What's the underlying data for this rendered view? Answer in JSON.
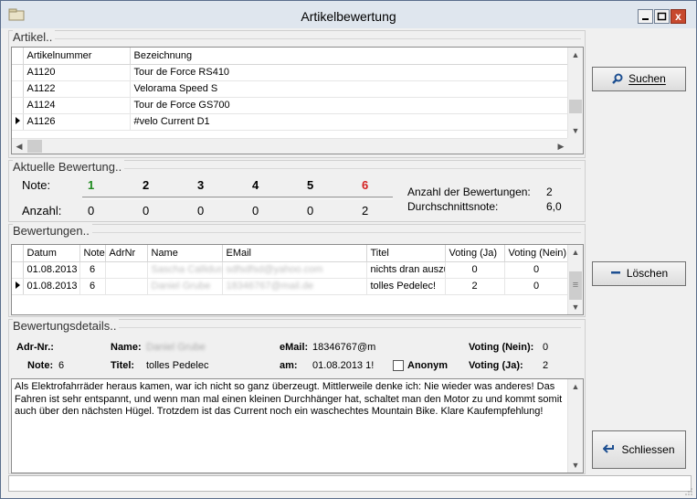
{
  "window": {
    "title": "Artikelbewertung",
    "close_glyph": "x"
  },
  "artikel": {
    "group_label": "Artikel..",
    "columns": [
      "Artikelnummer",
      "Bezeichnung"
    ],
    "rows": [
      {
        "nr": "A1120",
        "bez": "Tour de Force RS410",
        "current": false
      },
      {
        "nr": "A1122",
        "bez": "Velorama Speed S",
        "current": false
      },
      {
        "nr": "A1124",
        "bez": "Tour de Force GS700",
        "current": false
      },
      {
        "nr": "A1126",
        "bez": "#velo Current D1",
        "current": true
      }
    ]
  },
  "aktuelle": {
    "group_label": "Aktuelle Bewertung..",
    "note_label": "Note:",
    "anzahl_label": "Anzahl:",
    "notes": [
      "1",
      "2",
      "3",
      "4",
      "5",
      "6"
    ],
    "counts": [
      "0",
      "0",
      "0",
      "0",
      "0",
      "2"
    ],
    "anzahl_bew_label": "Anzahl der Bewertungen:",
    "anzahl_bew_value": "2",
    "durchschnitt_label": "Durchschnittsnote:",
    "durchschnitt_value": "6,0",
    "note_colors": {
      "first": "#1f8a1f",
      "last": "#d42020"
    }
  },
  "bewertungen": {
    "group_label": "Bewertungen..",
    "columns": [
      "Datum",
      "Note",
      "AdrNr",
      "Name",
      "EMail",
      "Titel",
      "Voting (Ja)",
      "Voting (Nein)"
    ],
    "rows": [
      {
        "datum": "01.08.2013",
        "note": "6",
        "adrnr": "",
        "name": "Sascha Callidus",
        "email": "sdfsdfsd@yahoo.com",
        "titel": "nichts dran auszu",
        "ja": "0",
        "nein": "0",
        "current": false
      },
      {
        "datum": "01.08.2013",
        "note": "6",
        "adrnr": "",
        "name": "Daniel Grube",
        "email": "18346767@mail.de",
        "titel": "tolles Pedelec!",
        "ja": "2",
        "nein": "0",
        "current": true
      }
    ]
  },
  "details": {
    "group_label": "Bewertungsdetails..",
    "adrnr_label": "Adr-Nr.:",
    "name_label": "Name:",
    "name_value": "Daniel Grube",
    "email_label": "eMail:",
    "email_value": "18346767@m",
    "voting_nein_label": "Voting (Nein):",
    "voting_nein_value": "0",
    "note_label": "Note:",
    "note_value": "6",
    "titel_label": "Titel:",
    "titel_value": "tolles Pedelec",
    "am_label": "am:",
    "am_value": "01.08.2013 1!",
    "anonym_label": "Anonym",
    "voting_ja_label": "Voting (Ja):",
    "voting_ja_value": "2",
    "text": "Als Elektrofahrräder heraus kamen, war ich nicht so ganz überzeugt. Mittlerweile denke ich: Nie wieder was anderes! Das Fahren ist sehr entspannt, und wenn man mal einen kleinen Durchhänger hat, schaltet man den Motor zu und kommt somit auch über den nächsten Hügel. Trotzdem ist das Current noch ein waschechtes Mountain Bike.  Klare Kaufempfehlung!"
  },
  "buttons": {
    "suchen": "Suchen",
    "loeschen": "Löschen",
    "schliessen": "Schliessen"
  }
}
